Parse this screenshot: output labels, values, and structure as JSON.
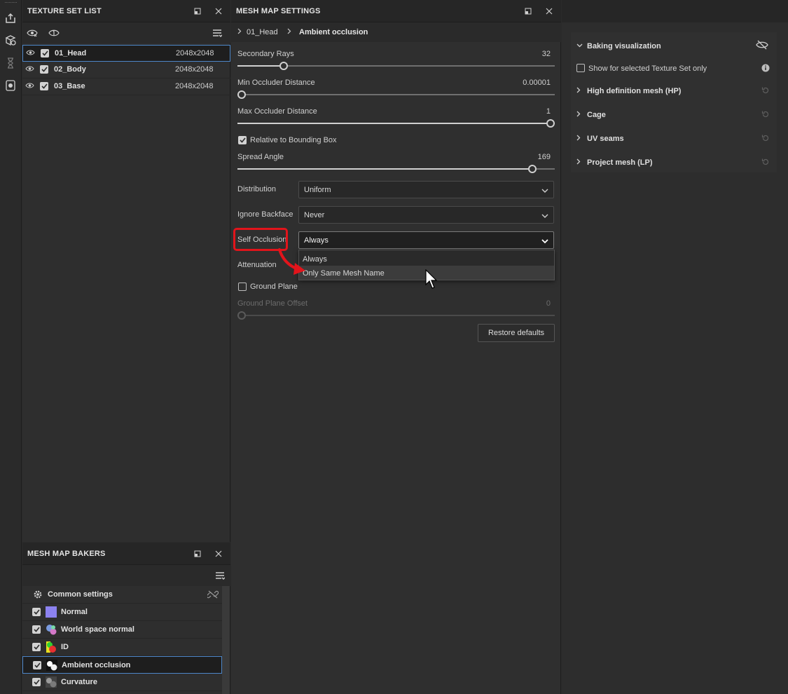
{
  "texture_set_list": {
    "title": "TEXTURE SET LIST",
    "rows": [
      {
        "name": "01_Head",
        "resolution": "2048x2048"
      },
      {
        "name": "02_Body",
        "resolution": "2048x2048"
      },
      {
        "name": "03_Base",
        "resolution": "2048x2048"
      }
    ]
  },
  "mesh_map_bakers": {
    "title": "MESH MAP BAKERS",
    "common_settings": "Common settings",
    "bakers": [
      {
        "name": "Normal",
        "thumb_color": "#8c82f0"
      },
      {
        "name": "World space normal",
        "thumb_color": "#7a9be0"
      },
      {
        "name": "ID",
        "thumb_color": "#e83030"
      },
      {
        "name": "Ambient occlusion",
        "thumb_color": "#ffffff"
      },
      {
        "name": "Curvature",
        "thumb_color": "#909090"
      }
    ]
  },
  "mesh_map_settings": {
    "title": "MESH MAP SETTINGS",
    "breadcrumb": [
      "01_Head",
      "Ambient occlusion"
    ],
    "secondary_rays": {
      "label": "Secondary Rays",
      "value": "32",
      "fraction": 0.135
    },
    "min_occluder": {
      "label": "Min Occluder Distance",
      "value": "0.00001",
      "fraction": 0.0
    },
    "max_occluder": {
      "label": "Max Occluder Distance",
      "value": "1",
      "fraction": 1.0
    },
    "relative_bbox": {
      "label": "Relative to Bounding Box",
      "checked": true
    },
    "spread_angle": {
      "label": "Spread Angle",
      "value": "169",
      "fraction": 0.94
    },
    "distribution": {
      "label": "Distribution",
      "value": "Uniform"
    },
    "ignore_backface": {
      "label": "Ignore Backface",
      "value": "Never"
    },
    "self_occlusion": {
      "label": "Self Occlusion",
      "value": "Always",
      "options": [
        "Always",
        "Only Same Mesh Name"
      ]
    },
    "attenuation": {
      "label": "Attenuation"
    },
    "ground_plane": {
      "label": "Ground Plane",
      "checked": false
    },
    "ground_plane_offset": {
      "label": "Ground Plane Offset",
      "value": "0",
      "fraction": 0.0
    },
    "restore_defaults": "Restore defaults"
  },
  "baking_panel": {
    "baking_visualization": "Baking visualization",
    "show_for_selected": "Show for selected Texture Set only",
    "sections": [
      "High definition mesh (HP)",
      "Cage",
      "UV seams",
      "Project mesh (LP)"
    ]
  },
  "colors": {
    "accent_blue": "#4d86c8",
    "highlight_red": "#e2141b"
  }
}
